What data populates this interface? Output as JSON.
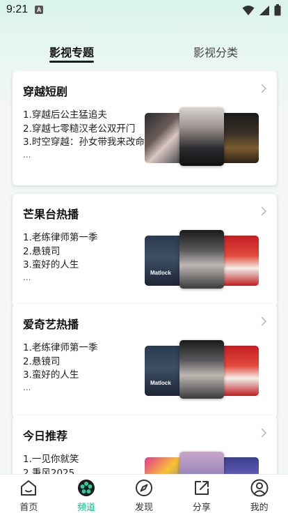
{
  "status_bar": {
    "time": "9:21",
    "notification": "A"
  },
  "tabs": [
    {
      "label": "影视专题",
      "active": true
    },
    {
      "label": "影视分类",
      "active": false
    }
  ],
  "cards": [
    {
      "title": "穿越短剧",
      "items": [
        "1.穿越后公主猛追夫",
        "2.穿越七零糙汉老公双开门",
        "3.时空穿越：孙女带我来改命"
      ],
      "more": "..."
    },
    {
      "title": "芒果台热播",
      "items": [
        "1.老练律师第一季",
        "2.悬镜司",
        "3.蛮好的人生"
      ],
      "more": "...",
      "poster_label": "Matlock"
    },
    {
      "title": "爱奇艺热播",
      "items": [
        "1.老练律师第一季",
        "2.悬镜司",
        "3.蛮好的人生"
      ],
      "more": "...",
      "poster_label": "Matlock"
    },
    {
      "title": "今日推荐",
      "items": [
        "1.一见你就笑",
        "2.秉风2025"
      ],
      "more": ""
    }
  ],
  "bottom_nav": [
    {
      "label": "首页",
      "icon": "home-icon"
    },
    {
      "label": "频道",
      "icon": "film-reel-icon",
      "active": true
    },
    {
      "label": "发现",
      "icon": "compass-icon"
    },
    {
      "label": "分享",
      "icon": "share-icon"
    },
    {
      "label": "我的",
      "icon": "profile-icon"
    }
  ],
  "colors": {
    "accent": "#16b58f",
    "text": "#111111",
    "card_bg": "#ffffff"
  }
}
